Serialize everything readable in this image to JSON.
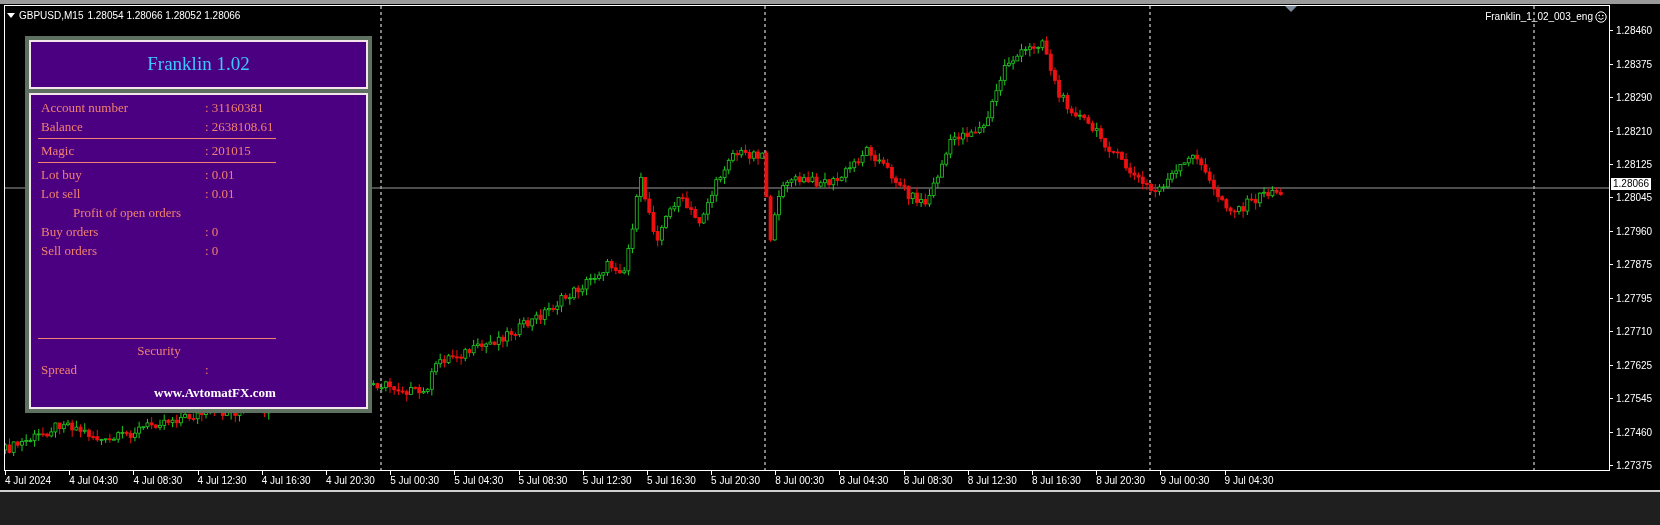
{
  "chart_header": {
    "symbol": "GBPUSD,M15",
    "quotes": "1.28054 1.28066 1.28052 1.28066"
  },
  "expert_label": "Franklin_1_02_003_eng",
  "panel": {
    "title": "Franklin 1.02",
    "rows": [
      {
        "kind": "pair",
        "label": "Account number",
        "value": ": 31160381"
      },
      {
        "kind": "pair",
        "label": "Balance",
        "value": ": 2638108.61"
      },
      {
        "kind": "rule"
      },
      {
        "kind": "pair",
        "label": "Magic",
        "value": ": 201015"
      },
      {
        "kind": "rule"
      },
      {
        "kind": "pair",
        "label": "Lot buy",
        "value": ": 0.01"
      },
      {
        "kind": "pair",
        "label": "Lot sell",
        "value": ": 0.01"
      },
      {
        "kind": "caption",
        "label": "Profit of open orders"
      },
      {
        "kind": "pair",
        "label": "Buy orders",
        "value": ": 0"
      },
      {
        "kind": "pair",
        "label": "Sell orders",
        "value": ": 0"
      }
    ],
    "bottom_rows": [
      {
        "kind": "rule"
      },
      {
        "kind": "heading",
        "label": "Security"
      },
      {
        "kind": "pair",
        "label": "Spread",
        "value": ":"
      }
    ],
    "footer": "www.AvtomatFX.com"
  },
  "price_axis": {
    "ticks": [
      "1.28460",
      "1.28375",
      "1.28290",
      "1.28210",
      "1.28125",
      "1.28045",
      "1.27960",
      "1.27875",
      "1.27795",
      "1.27710",
      "1.27625",
      "1.27545",
      "1.27460",
      "1.27375"
    ],
    "current": "1.28066"
  },
  "time_axis": {
    "labels": [
      "4 Jul 2024",
      "4 Jul 04:30",
      "4 Jul 08:30",
      "4 Jul 12:30",
      "4 Jul 16:30",
      "4 Jul 20:30",
      "5 Jul 00:30",
      "5 Jul 04:30",
      "5 Jul 08:30",
      "5 Jul 12:30",
      "5 Jul 16:30",
      "5 Jul 20:30",
      "8 Jul 00:30",
      "8 Jul 04:30",
      "8 Jul 08:30",
      "8 Jul 12:30",
      "8 Jul 16:30",
      "8 Jul 20:30",
      "9 Jul 00:30",
      "9 Jul 04:30"
    ]
  }
}
